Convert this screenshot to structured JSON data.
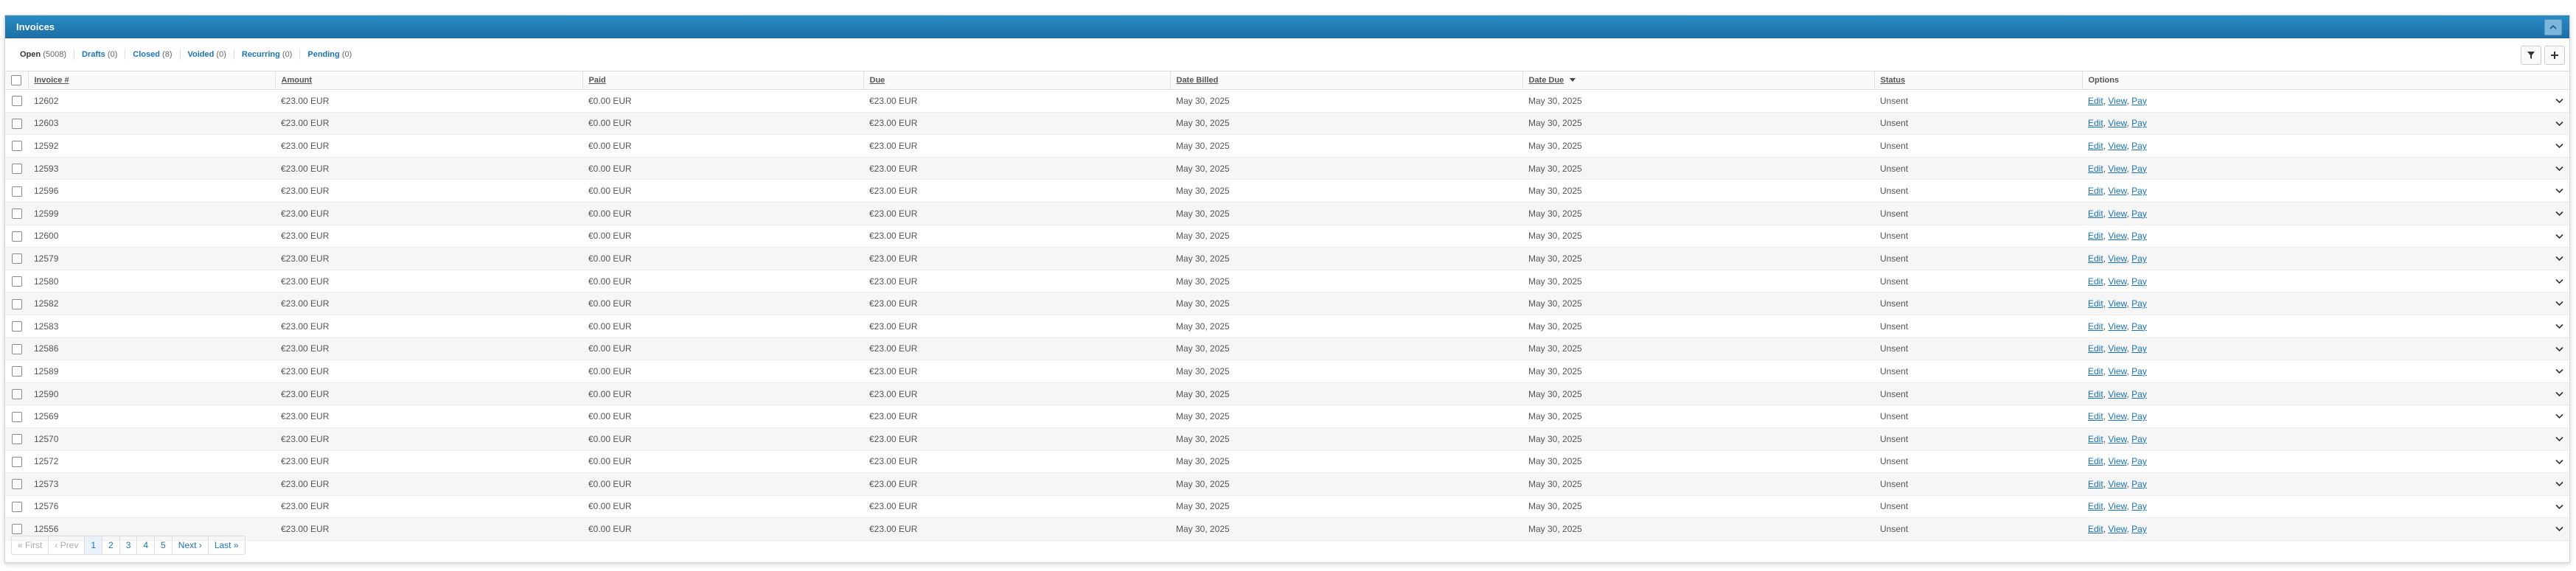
{
  "panel": {
    "title": "Invoices"
  },
  "tabs": [
    {
      "label": "Open",
      "count": "(5008)",
      "active": true
    },
    {
      "label": "Drafts",
      "count": "(0)"
    },
    {
      "label": "Closed",
      "count": "(8)"
    },
    {
      "label": "Voided",
      "count": "(0)"
    },
    {
      "label": "Recurring",
      "count": "(0)"
    },
    {
      "label": "Pending",
      "count": "(0)"
    }
  ],
  "columns": {
    "invoice": "Invoice #",
    "amount": "Amount",
    "paid": "Paid",
    "due": "Due",
    "date_billed": "Date Billed",
    "date_due": "Date Due",
    "status": "Status",
    "options": "Options"
  },
  "rows": [
    {
      "id": "12602",
      "amount": "€23.00 EUR",
      "paid": "€0.00 EUR",
      "due": "€23.00 EUR",
      "billed": "May 30, 2025",
      "date_due": "May 30, 2025",
      "status": "Unsent"
    },
    {
      "id": "12603",
      "amount": "€23.00 EUR",
      "paid": "€0.00 EUR",
      "due": "€23.00 EUR",
      "billed": "May 30, 2025",
      "date_due": "May 30, 2025",
      "status": "Unsent"
    },
    {
      "id": "12592",
      "amount": "€23.00 EUR",
      "paid": "€0.00 EUR",
      "due": "€23.00 EUR",
      "billed": "May 30, 2025",
      "date_due": "May 30, 2025",
      "status": "Unsent"
    },
    {
      "id": "12593",
      "amount": "€23.00 EUR",
      "paid": "€0.00 EUR",
      "due": "€23.00 EUR",
      "billed": "May 30, 2025",
      "date_due": "May 30, 2025",
      "status": "Unsent"
    },
    {
      "id": "12596",
      "amount": "€23.00 EUR",
      "paid": "€0.00 EUR",
      "due": "€23.00 EUR",
      "billed": "May 30, 2025",
      "date_due": "May 30, 2025",
      "status": "Unsent"
    },
    {
      "id": "12599",
      "amount": "€23.00 EUR",
      "paid": "€0.00 EUR",
      "due": "€23.00 EUR",
      "billed": "May 30, 2025",
      "date_due": "May 30, 2025",
      "status": "Unsent"
    },
    {
      "id": "12600",
      "amount": "€23.00 EUR",
      "paid": "€0.00 EUR",
      "due": "€23.00 EUR",
      "billed": "May 30, 2025",
      "date_due": "May 30, 2025",
      "status": "Unsent"
    },
    {
      "id": "12579",
      "amount": "€23.00 EUR",
      "paid": "€0.00 EUR",
      "due": "€23.00 EUR",
      "billed": "May 30, 2025",
      "date_due": "May 30, 2025",
      "status": "Unsent"
    },
    {
      "id": "12580",
      "amount": "€23.00 EUR",
      "paid": "€0.00 EUR",
      "due": "€23.00 EUR",
      "billed": "May 30, 2025",
      "date_due": "May 30, 2025",
      "status": "Unsent"
    },
    {
      "id": "12582",
      "amount": "€23.00 EUR",
      "paid": "€0.00 EUR",
      "due": "€23.00 EUR",
      "billed": "May 30, 2025",
      "date_due": "May 30, 2025",
      "status": "Unsent"
    },
    {
      "id": "12583",
      "amount": "€23.00 EUR",
      "paid": "€0.00 EUR",
      "due": "€23.00 EUR",
      "billed": "May 30, 2025",
      "date_due": "May 30, 2025",
      "status": "Unsent"
    },
    {
      "id": "12586",
      "amount": "€23.00 EUR",
      "paid": "€0.00 EUR",
      "due": "€23.00 EUR",
      "billed": "May 30, 2025",
      "date_due": "May 30, 2025",
      "status": "Unsent"
    },
    {
      "id": "12589",
      "amount": "€23.00 EUR",
      "paid": "€0.00 EUR",
      "due": "€23.00 EUR",
      "billed": "May 30, 2025",
      "date_due": "May 30, 2025",
      "status": "Unsent"
    },
    {
      "id": "12590",
      "amount": "€23.00 EUR",
      "paid": "€0.00 EUR",
      "due": "€23.00 EUR",
      "billed": "May 30, 2025",
      "date_due": "May 30, 2025",
      "status": "Unsent"
    },
    {
      "id": "12569",
      "amount": "€23.00 EUR",
      "paid": "€0.00 EUR",
      "due": "€23.00 EUR",
      "billed": "May 30, 2025",
      "date_due": "May 30, 2025",
      "status": "Unsent"
    },
    {
      "id": "12570",
      "amount": "€23.00 EUR",
      "paid": "€0.00 EUR",
      "due": "€23.00 EUR",
      "billed": "May 30, 2025",
      "date_due": "May 30, 2025",
      "status": "Unsent"
    },
    {
      "id": "12572",
      "amount": "€23.00 EUR",
      "paid": "€0.00 EUR",
      "due": "€23.00 EUR",
      "billed": "May 30, 2025",
      "date_due": "May 30, 2025",
      "status": "Unsent"
    },
    {
      "id": "12573",
      "amount": "€23.00 EUR",
      "paid": "€0.00 EUR",
      "due": "€23.00 EUR",
      "billed": "May 30, 2025",
      "date_due": "May 30, 2025",
      "status": "Unsent"
    },
    {
      "id": "12576",
      "amount": "€23.00 EUR",
      "paid": "€0.00 EUR",
      "due": "€23.00 EUR",
      "billed": "May 30, 2025",
      "date_due": "May 30, 2025",
      "status": "Unsent"
    },
    {
      "id": "12556",
      "amount": "€23.00 EUR",
      "paid": "€0.00 EUR",
      "due": "€23.00 EUR",
      "billed": "May 30, 2025",
      "date_due": "May 30, 2025",
      "status": "Unsent"
    }
  ],
  "row_actions": {
    "edit": "Edit",
    "view": "View",
    "pay": "Pay"
  },
  "pagination": {
    "first": "« First",
    "prev": "‹ Prev",
    "pages": [
      "1",
      "2",
      "3",
      "4",
      "5"
    ],
    "current": "1",
    "next": "Next ›",
    "last": "Last »"
  },
  "icons": {
    "collapse": "chevron-up-icon",
    "filter": "filter-icon",
    "add": "plus-icon",
    "sort": "sort-desc-icon",
    "expand": "chevron-down-icon"
  },
  "colors": {
    "header": "#1d6fa5",
    "link": "#1a73b5",
    "overdue": "#c0262d"
  }
}
